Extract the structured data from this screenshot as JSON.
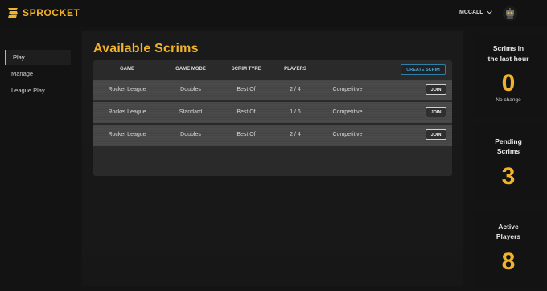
{
  "brand": {
    "name": "SPROCKET",
    "accent": "#f2b32a"
  },
  "header": {
    "username": "MCCALL"
  },
  "sidebar": {
    "items": [
      {
        "label": "Play",
        "active": true
      },
      {
        "label": "Manage"
      },
      {
        "label": "League Play"
      }
    ]
  },
  "main": {
    "title": "Available Scrims",
    "columns": [
      "GAME",
      "GAME MODE",
      "SCRIM TYPE",
      "PLAYERS"
    ],
    "create_label": "CREATE SCRIM",
    "join_label": "JOIN",
    "rows": [
      {
        "game": "Rocket League",
        "mode": "Doubles",
        "type": "Best Of",
        "players": "2 / 4",
        "skill": "Competitive"
      },
      {
        "game": "Rocket League",
        "mode": "Standard",
        "type": "Best Of",
        "players": "1 / 6",
        "skill": "Competitive"
      },
      {
        "game": "Rocket League",
        "mode": "Doubles",
        "type": "Best Of",
        "players": "2 / 4",
        "skill": "Competitive"
      }
    ]
  },
  "stats": [
    {
      "label_line1": "Scrims in",
      "label_line2": "the last hour",
      "value": "0",
      "sub": "No change"
    },
    {
      "label_line1": "Pending",
      "label_line2": "Scrims",
      "value": "3"
    },
    {
      "label_line1": "Active",
      "label_line2": "Players",
      "value": "8"
    }
  ]
}
